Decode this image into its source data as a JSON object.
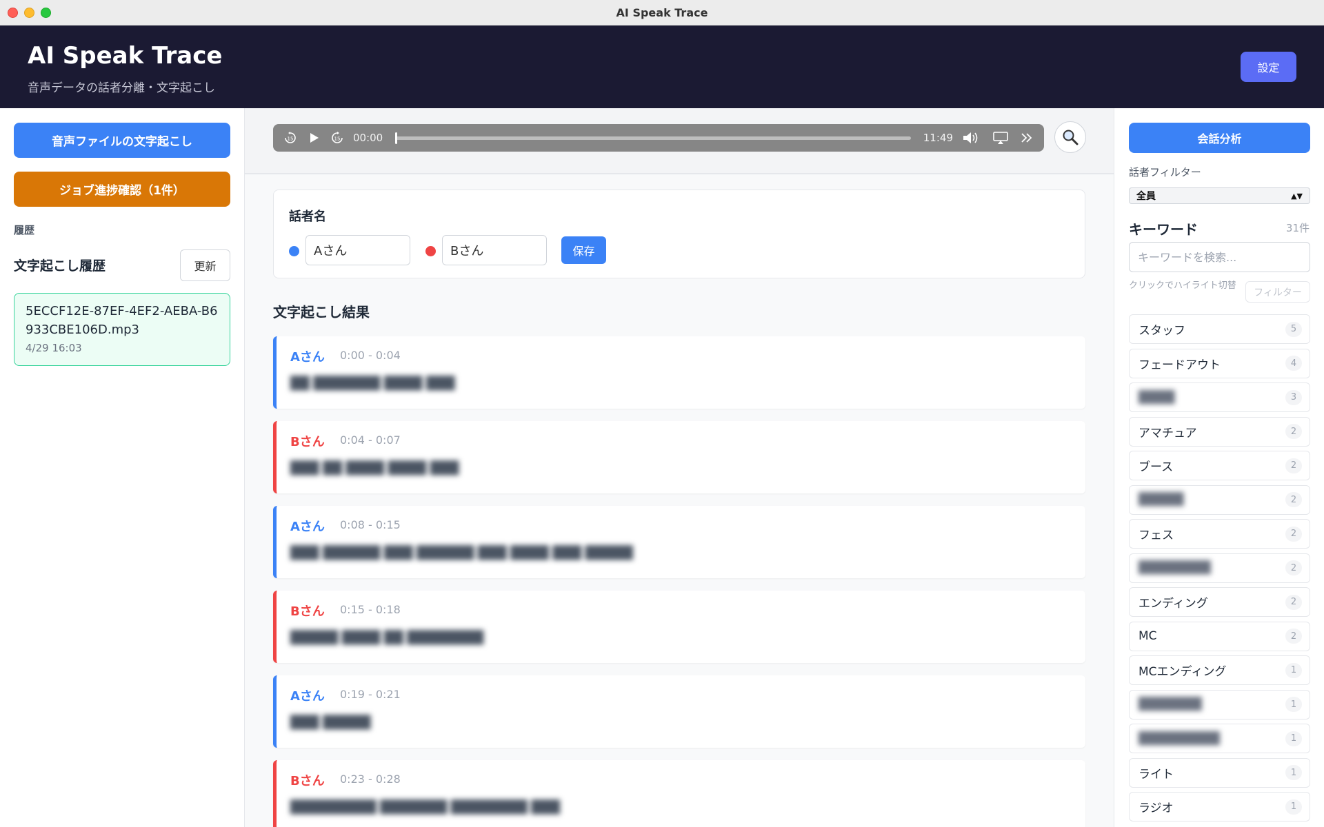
{
  "window": {
    "title": "AI Speak Trace"
  },
  "header": {
    "title": "AI Speak Trace",
    "subtitle": "音声データの話者分離・文字起こし",
    "settings_label": "設定"
  },
  "left": {
    "upload_label": "音声ファイルの文字起こし",
    "jobs_label": "ジョブ進捗確認（1件）",
    "history_label": "履歴",
    "history_title": "文字起こし履歴",
    "refresh_label": "更新",
    "items": [
      {
        "name": "5ECCF12E-87EF-4EF2-AEBA-B6933CBE106D.mp3",
        "date": "4/29 16:03"
      }
    ]
  },
  "player": {
    "current_time": "00:00",
    "duration": "11:49",
    "progress": 0
  },
  "speakers": {
    "title": "話者名",
    "a_value": "Aさん",
    "b_value": "Bさん",
    "save_label": "保存",
    "colors": {
      "a": "#3b82f6",
      "b": "#ef4444"
    }
  },
  "results": {
    "title": "文字起こし結果",
    "segments": [
      {
        "speaker": "Aさん",
        "time": "0:00 - 0:04",
        "text": "██ ███████ ████ ███"
      },
      {
        "speaker": "Bさん",
        "time": "0:04 - 0:07",
        "text": "███ ██ ████ ████ ███"
      },
      {
        "speaker": "Aさん",
        "time": "0:08 - 0:15",
        "text": "███ ██████ ███ ██████ ███ ████ ███ █████"
      },
      {
        "speaker": "Bさん",
        "time": "0:15 - 0:18",
        "text": "█████ ████ ██ ████████"
      },
      {
        "speaker": "Aさん",
        "time": "0:19 - 0:21",
        "text": "███ █████"
      },
      {
        "speaker": "Bさん",
        "time": "0:23 - 0:28",
        "text": "█████████ ███████ ████████ ███"
      }
    ]
  },
  "right": {
    "analysis_label": "会話分析",
    "filter_label": "話者フィルター",
    "filter_value": "全員",
    "keywords_title": "キーワード",
    "keywords_count": "31件",
    "search_placeholder": "キーワードを検索...",
    "hint": "クリックでハイライト切替",
    "filter_button": "フィルター",
    "keywords": [
      {
        "name": "スタッフ",
        "count": "5",
        "blurred": false
      },
      {
        "name": "フェードアウト",
        "count": "4",
        "blurred": false
      },
      {
        "name": "████",
        "count": "3",
        "blurred": true
      },
      {
        "name": "アマチュア",
        "count": "2",
        "blurred": false
      },
      {
        "name": "ブース",
        "count": "2",
        "blurred": false
      },
      {
        "name": "█████",
        "count": "2",
        "blurred": true
      },
      {
        "name": "フェス",
        "count": "2",
        "blurred": false
      },
      {
        "name": "████████",
        "count": "2",
        "blurred": true
      },
      {
        "name": "エンディング",
        "count": "2",
        "blurred": false
      },
      {
        "name": "MC",
        "count": "2",
        "blurred": false
      },
      {
        "name": "MCエンディング",
        "count": "1",
        "blurred": false
      },
      {
        "name": "███████",
        "count": "1",
        "blurred": true
      },
      {
        "name": "█████████",
        "count": "1",
        "blurred": true
      },
      {
        "name": "ライト",
        "count": "1",
        "blurred": false
      },
      {
        "name": "ラジオ",
        "count": "1",
        "blurred": false
      }
    ]
  },
  "icons": {
    "rewind": "rewind-15-icon",
    "play": "play-icon",
    "forward": "forward-15-icon",
    "volume": "volume-icon",
    "airplay": "airplay-icon",
    "more": "double-chevron-icon",
    "search": "search-icon"
  }
}
